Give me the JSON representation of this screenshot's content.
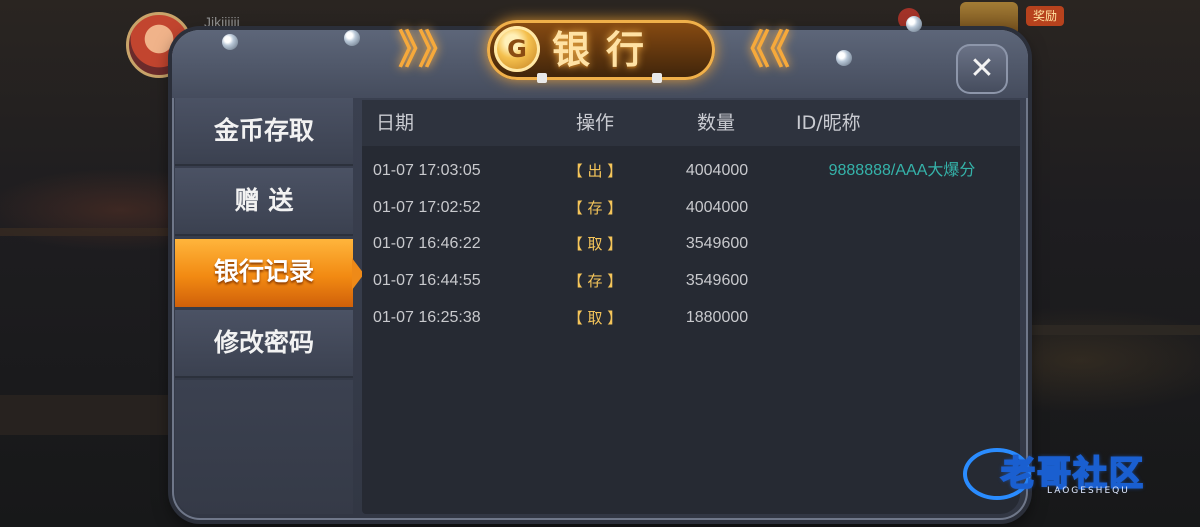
{
  "player": {
    "name": "Jikiiiiii"
  },
  "reward_label": "奖励",
  "title": {
    "text": "银行",
    "coin_glyph": "G",
    "left_deco": "》》",
    "right_deco": "《《"
  },
  "close_glyph": "✕",
  "tabs": [
    {
      "label": "金币存取",
      "active": false
    },
    {
      "label": "赠 送",
      "active": false
    },
    {
      "label": "银行记录",
      "active": true
    },
    {
      "label": "修改密码",
      "active": false
    }
  ],
  "records": {
    "headers": {
      "date": "日期",
      "op": "操作",
      "qty": "数量",
      "id": "ID/昵称"
    },
    "rows": [
      {
        "date": "01-07 17:03:05",
        "op": "【 出 】",
        "qty": "4004000",
        "id": "9888888/AAA大爆分"
      },
      {
        "date": "01-07 17:02:52",
        "op": "【 存 】",
        "qty": "4004000",
        "id": ""
      },
      {
        "date": "01-07 16:46:22",
        "op": "【 取 】",
        "qty": "3549600",
        "id": ""
      },
      {
        "date": "01-07 16:44:55",
        "op": "【 存 】",
        "qty": "3549600",
        "id": ""
      },
      {
        "date": "01-07 16:25:38",
        "op": "【 取 】",
        "qty": "1880000",
        "id": ""
      }
    ]
  },
  "watermark": {
    "text": "老哥社区",
    "sub": "LAOGESHEQU"
  },
  "colors": {
    "accent": "#f28a12",
    "id_text": "#35b3aa",
    "op_text": "#f5c55a"
  }
}
